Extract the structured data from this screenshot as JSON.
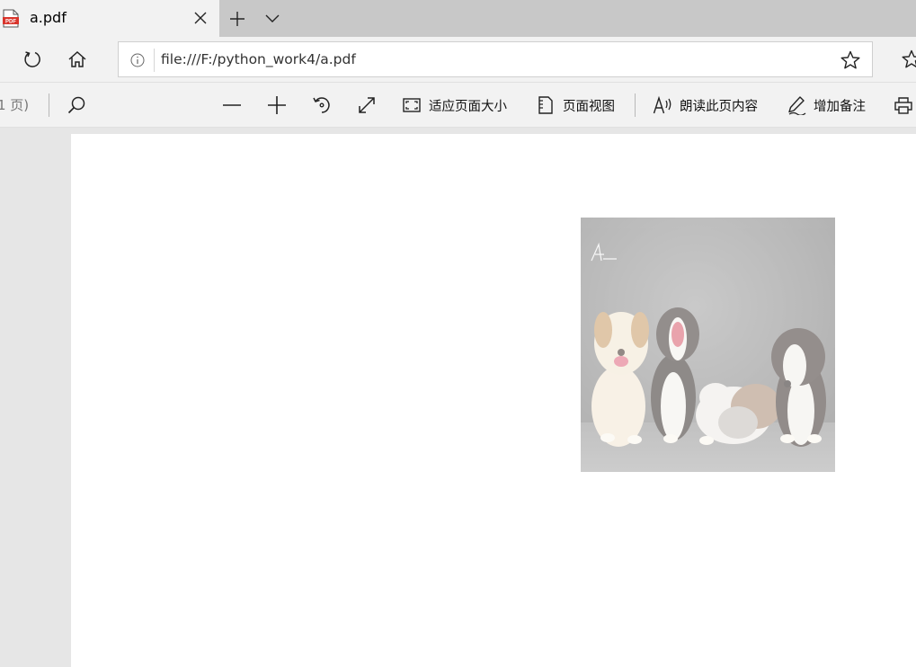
{
  "tab": {
    "title": "a.pdf",
    "favicon_label": "PDF",
    "favicon_color": "#d9342b"
  },
  "address_bar": {
    "url": "file:///F:/python_work4/a.pdf"
  },
  "pdf_toolbar": {
    "page_count": "1 页)",
    "fit_page_label": "适应页面大小",
    "page_view_label": "页面视图",
    "read_aloud_label": "朗读此页内容",
    "add_notes_label": "增加备注"
  },
  "document": {
    "image_subject": "five puppies in front of grey backdrop",
    "image_opacity": 0.55
  }
}
